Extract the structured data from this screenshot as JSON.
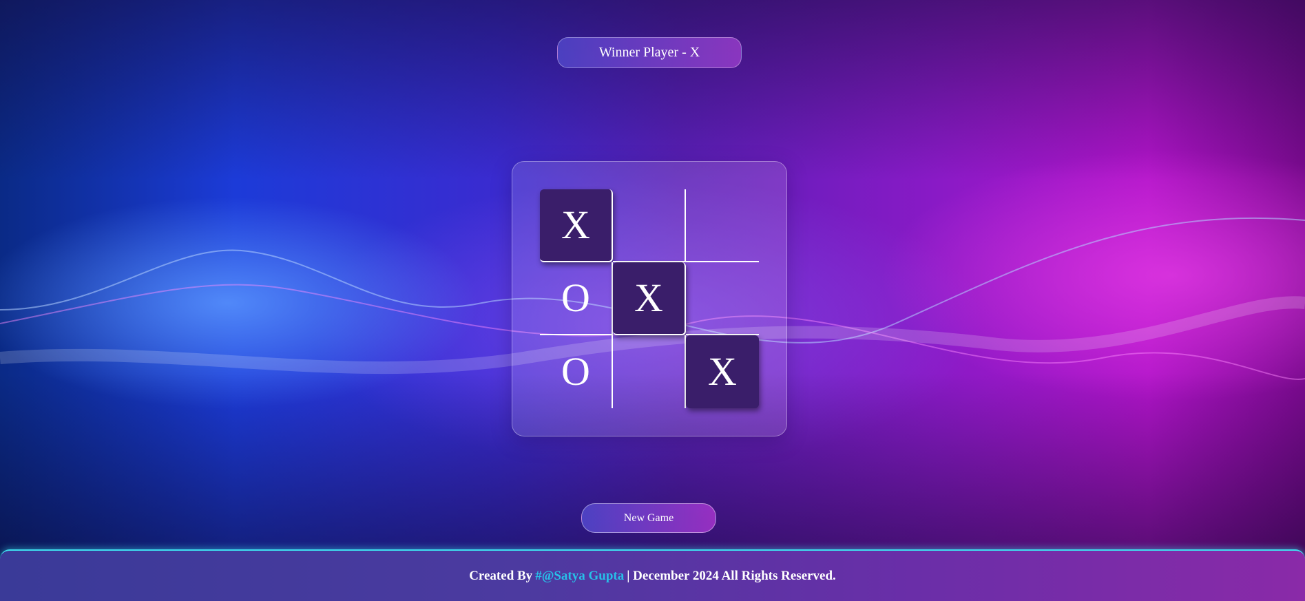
{
  "status": {
    "text": "Winner Player - X"
  },
  "board": {
    "cells": [
      "X",
      "",
      "",
      "O",
      "X",
      "",
      "O",
      "",
      "X"
    ],
    "winning_cells": [
      0,
      4,
      8
    ]
  },
  "controls": {
    "new_game_label": "New Game"
  },
  "footer": {
    "prefix": "Created By",
    "author": "#@Satya Gupta",
    "suffix": "| December 2024 All Rights Reserved.",
    "author_color": "#27c0e8"
  },
  "colors": {
    "winning_cell_bg": "#3a1e6a",
    "footer_border": "#3fe0f0"
  }
}
